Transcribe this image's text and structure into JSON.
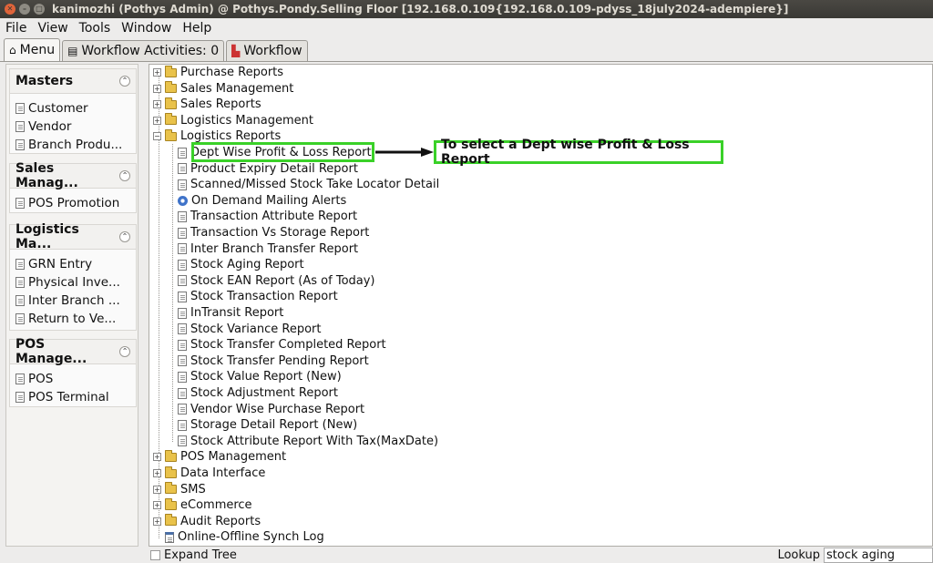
{
  "window": {
    "title": "kanimozhi (Pothys Admin) @ Pothys.Pondy.Selling Floor [192.168.0.109{192.168.0.109-pdyss_18july2024-adempiere}]"
  },
  "menubar": [
    "File",
    "View",
    "Tools",
    "Window",
    "Help"
  ],
  "tabs": [
    {
      "label": "Menu",
      "icon": "home-icon"
    },
    {
      "label": "Workflow Activities: 0",
      "icon": "table-icon"
    },
    {
      "label": "Workflow",
      "icon": "workflow-icon"
    }
  ],
  "sidebar": {
    "panels": [
      {
        "title": "Masters",
        "items": [
          "Customer",
          "Vendor",
          "Branch Produ..."
        ]
      },
      {
        "title": "Sales Manag...",
        "items": [
          "POS Promotion"
        ]
      },
      {
        "title": "Logistics Ma...",
        "items": [
          "GRN Entry",
          "Physical Inve...",
          "Inter Branch ...",
          "Return to Ve..."
        ]
      },
      {
        "title": "POS Manage...",
        "items": [
          "POS",
          "POS Terminal"
        ]
      }
    ]
  },
  "tree": {
    "top_folders": [
      "Purchase Reports",
      "Sales Management",
      "Sales Reports",
      "Logistics Management"
    ],
    "open_folder": "Logistics Reports",
    "children": [
      {
        "label": "Dept Wise Profit & Loss Report",
        "icon": "document-icon"
      },
      {
        "label": "Product Expiry Detail Report",
        "icon": "document-icon"
      },
      {
        "label": "Scanned/Missed Stock Take Locator Detail",
        "icon": "document-icon"
      },
      {
        "label": "On Demand Mailing Alerts",
        "icon": "gear-icon"
      },
      {
        "label": "Transaction Attribute Report",
        "icon": "document-icon"
      },
      {
        "label": "Transaction Vs Storage Report",
        "icon": "document-icon"
      },
      {
        "label": "Inter Branch Transfer Report",
        "icon": "document-icon"
      },
      {
        "label": "Stock Aging Report",
        "icon": "document-icon"
      },
      {
        "label": "Stock EAN Report (As of Today)",
        "icon": "document-icon"
      },
      {
        "label": "Stock Transaction Report",
        "icon": "document-icon"
      },
      {
        "label": "InTransit Report",
        "icon": "document-icon"
      },
      {
        "label": "Stock Variance Report",
        "icon": "document-icon"
      },
      {
        "label": "Stock Transfer Completed Report",
        "icon": "document-icon"
      },
      {
        "label": "Stock Transfer Pending Report",
        "icon": "document-icon"
      },
      {
        "label": "Stock Value Report (New)",
        "icon": "document-icon"
      },
      {
        "label": "Stock Adjustment Report",
        "icon": "document-icon"
      },
      {
        "label": "Vendor Wise Purchase Report",
        "icon": "document-icon"
      },
      {
        "label": "Storage Detail Report (New)",
        "icon": "document-icon"
      },
      {
        "label": "Stock Attribute Report With Tax(MaxDate)",
        "icon": "document-icon"
      }
    ],
    "bottom_folders": [
      "POS Management",
      "Data Interface",
      "SMS",
      "eCommerce",
      "Audit Reports"
    ],
    "last_item": {
      "label": "Online-Offline Synch Log",
      "icon": "window-icon"
    }
  },
  "annotation": {
    "text": "To select a Dept wise Profit & Loss Report",
    "color": "#3ad128"
  },
  "statusbar": {
    "expand_label": "Expand Tree",
    "lookup_label": "Lookup",
    "lookup_value": "stock aging report"
  }
}
